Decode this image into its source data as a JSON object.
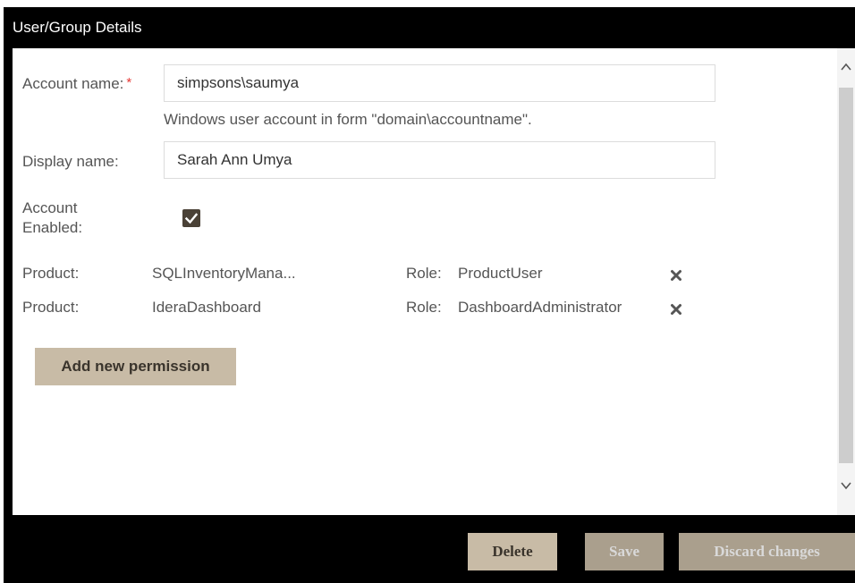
{
  "dialog": {
    "title": "User/Group Details"
  },
  "form": {
    "account_name_label": "Account name:",
    "required_marker": "*",
    "account_name_value": "simpsons\\saumya",
    "account_name_hint": "Windows user account in form \"domain\\accountname\".",
    "display_name_label": "Display name:",
    "display_name_value": "Sarah Ann Umya",
    "account_enabled_label_line1": "Account",
    "account_enabled_label_line2": "Enabled:",
    "account_enabled_checked": true
  },
  "permissions": [
    {
      "product_label": "Product:",
      "product_value": "SQLInventoryMana...",
      "role_label": "Role:",
      "role_value": "ProductUser"
    },
    {
      "product_label": "Product:",
      "product_value": "IderaDashboard",
      "role_label": "Role:",
      "role_value": "DashboardAdministrator"
    }
  ],
  "actions": {
    "add_permission_label": "Add new permission"
  },
  "footer": {
    "delete_label": "Delete",
    "save_label": "Save",
    "discard_label": "Discard changes"
  },
  "colors": {
    "title_bar": "#000000",
    "button_bg": "#c8bba6",
    "checkbox_bg": "#4a4136",
    "required": "#e53935"
  },
  "icons": {
    "remove": "close-icon",
    "check": "check-icon",
    "scroll_up": "chevron-up-icon",
    "scroll_down": "chevron-down-icon"
  }
}
